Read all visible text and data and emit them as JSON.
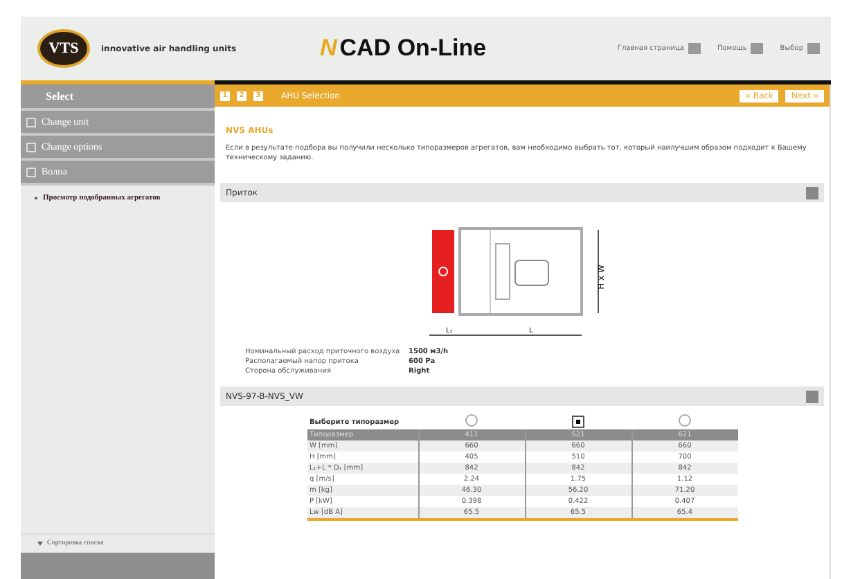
{
  "header": {
    "logo": "VTS",
    "tagline": "innovative air handling units",
    "app_mark": "N",
    "app_title": "CAD On-Line",
    "nav": [
      "Главная страница",
      "Помощь",
      "Выбор"
    ]
  },
  "sidebar": {
    "title": "Select",
    "items": [
      "Change unit",
      "Change options",
      "Волна"
    ],
    "sub_items": [
      "Просмотр подобранных агрегатов"
    ],
    "footer": "Сортировка списка"
  },
  "toolbar": {
    "steps": [
      "1",
      "2",
      "3"
    ],
    "title": "AHU Selection",
    "buttons": [
      "« Back",
      "Next »"
    ]
  },
  "content": {
    "heading": "NVS AHUs",
    "paragraph": "Если в результате подбора вы получили несколько типоразмеров агрегатов, вам необходимо выбрать тот, который наилучшим образом подходит к Вашему техническому заданию.",
    "supply": {
      "title": "Приток",
      "dims": [
        "H x W",
        "L₁",
        "L"
      ],
      "info": [
        {
          "label": "Номинальный расход приточного воздуха",
          "value": "1500 м3/h"
        },
        {
          "label": "Располагаемый напор притока",
          "value": "600 Pa"
        },
        {
          "label": "Сторона обслуживания",
          "value": "Right"
        }
      ]
    },
    "sizes": {
      "title": "NVS-97-B-NVS_VW",
      "choose_label": "Выберите типоразмер",
      "options": [
        {
          "selected": false
        },
        {
          "selected": true
        },
        {
          "selected": false
        }
      ],
      "header": [
        "Типоразмер",
        "411",
        "521",
        "621"
      ],
      "rows": [
        [
          "W [mm]",
          "660",
          "660",
          "660"
        ],
        [
          "H [mm]",
          "405",
          "510",
          "700"
        ],
        [
          "L₁+L * D₁ [mm]",
          "842",
          "842",
          "842"
        ],
        [
          "q [m/s]",
          "2.24",
          "1.75",
          "1.12"
        ],
        [
          "m [kg]",
          "46.30",
          "56.20",
          "71.20"
        ],
        [
          "P [kW]",
          "0.398",
          "0.422",
          "0.407"
        ],
        [
          "Lw [dB A]",
          "65.5",
          "65.5",
          "65.4"
        ]
      ]
    }
  }
}
